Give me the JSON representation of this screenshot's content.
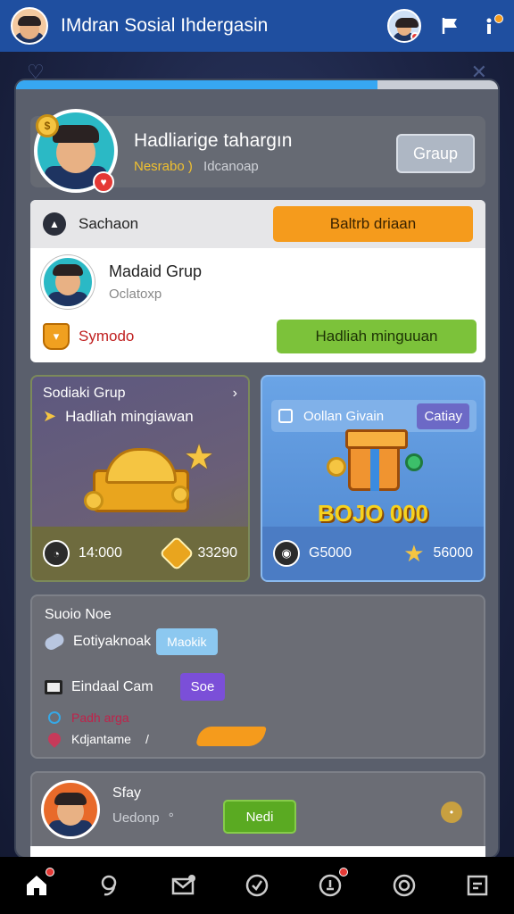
{
  "app": {
    "title": "IMdran Sosial Ihdergasin"
  },
  "topbar": {
    "icons": [
      "avatar",
      "flag-icon",
      "info-icon"
    ]
  },
  "progress": {
    "value": 0.75
  },
  "profile": {
    "name": "Hadliarige tahargın",
    "status": "Nesrabo )",
    "sub": "Idcanoap",
    "group_button": "Graup",
    "coin_label": "$"
  },
  "section": {
    "head_label": "Sachaon",
    "head_button": "Baltrb driaan",
    "member_name": "Madaid Grup",
    "member_sub": "Oclatoxp",
    "reward_label": "Symodo",
    "reward_button": "Hadliah minguuan"
  },
  "tile_left": {
    "title": "Sodiaki Grup",
    "sub": "Hadliah mingiawan",
    "stat1": "14:000",
    "stat2": "33290"
  },
  "tile_right": {
    "head_label": "Oollan Givain",
    "head_button": "Catiay",
    "amount": "BOJO 000",
    "stat1": "G5000",
    "stat2": "56000"
  },
  "notes": {
    "title": "Suoio Noe",
    "row1_label": "Eotiyaknoak",
    "row1_button": "Maokik",
    "row2_label": "Eindaal Cam",
    "row2_button": "Soe",
    "line1": "Padh arga",
    "line2": "Kdjantame",
    "line2_mark": "/"
  },
  "staff": {
    "name": "Sfay",
    "sub": "Uedonp",
    "sub_mark": "°",
    "button": "Nedi",
    "more": "•"
  },
  "nav": {
    "items": [
      "home",
      "search",
      "messages",
      "check",
      "alerts",
      "settings",
      "menu"
    ]
  },
  "colors": {
    "topbar": "#1f4fa0",
    "accent_orange": "#f59b1c",
    "accent_green": "#7cc23a",
    "accent_purple": "#7b4fd8",
    "progress": "#37a7f2"
  }
}
